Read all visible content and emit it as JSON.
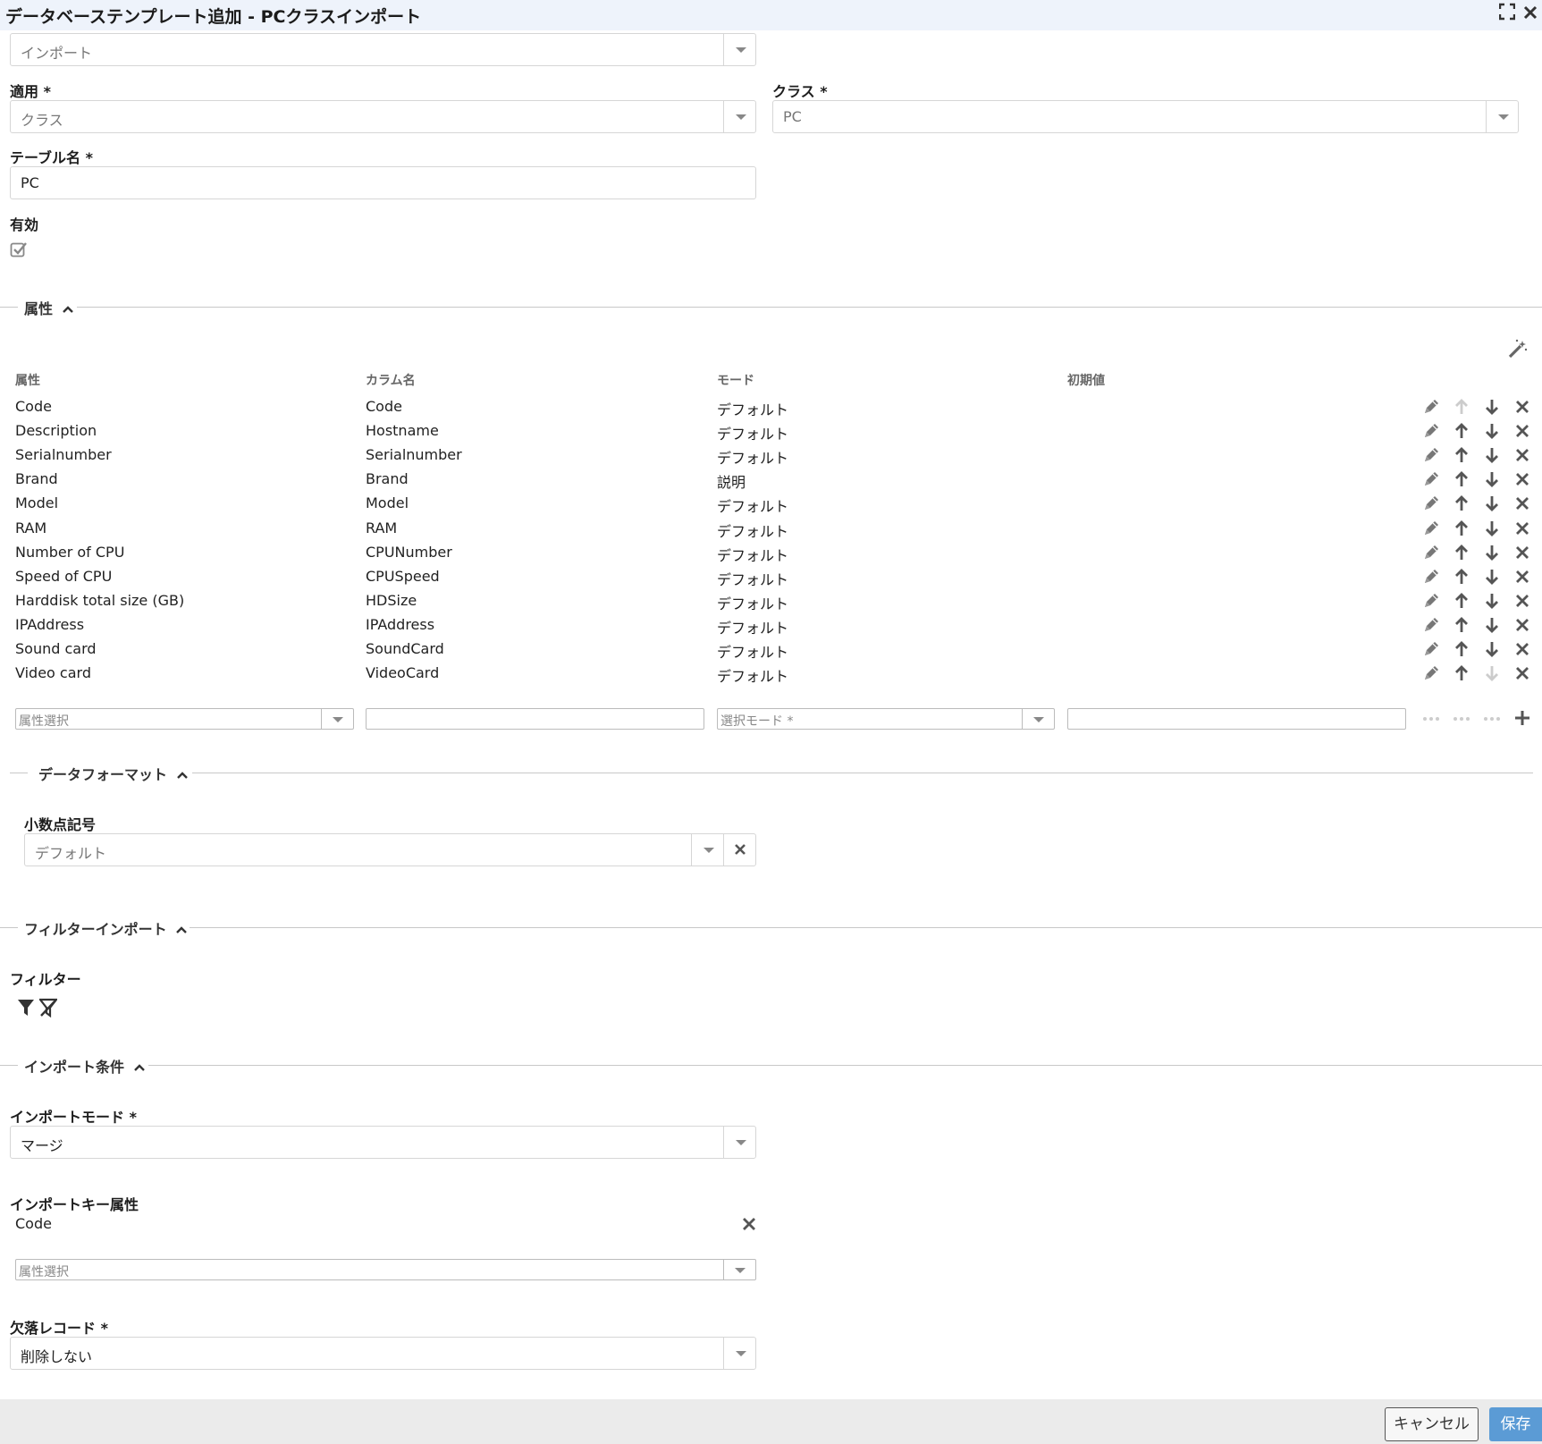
{
  "window": {
    "title": "データベーステンプレート追加 - PCクラスインポート",
    "maximize_icon": "expand-icon",
    "close_icon": "close-icon"
  },
  "form": {
    "type_select": {
      "value": "インポート"
    },
    "apply": {
      "label": "適用 *",
      "value": "クラス"
    },
    "class": {
      "label": "クラス *",
      "value": "PC"
    },
    "table_name": {
      "label": "テーブル名 *",
      "value": "PC"
    },
    "enabled": {
      "label": "有効",
      "checked": true
    }
  },
  "attributes_section": {
    "title": "属性",
    "columns": [
      "属性",
      "カラム名",
      "モード",
      "初期値"
    ],
    "rows": [
      {
        "attribute": "Code",
        "column": "Code",
        "mode": "デフォルト",
        "default": "",
        "up_enabled": false,
        "down_enabled": true
      },
      {
        "attribute": "Description",
        "column": "Hostname",
        "mode": "デフォルト",
        "default": "",
        "up_enabled": true,
        "down_enabled": true
      },
      {
        "attribute": "Serialnumber",
        "column": "Serialnumber",
        "mode": "デフォルト",
        "default": "",
        "up_enabled": true,
        "down_enabled": true
      },
      {
        "attribute": "Brand",
        "column": "Brand",
        "mode": "説明",
        "default": "",
        "up_enabled": true,
        "down_enabled": true
      },
      {
        "attribute": "Model",
        "column": "Model",
        "mode": "デフォルト",
        "default": "",
        "up_enabled": true,
        "down_enabled": true
      },
      {
        "attribute": "RAM",
        "column": "RAM",
        "mode": "デフォルト",
        "default": "",
        "up_enabled": true,
        "down_enabled": true
      },
      {
        "attribute": "Number of CPU",
        "column": "CPUNumber",
        "mode": "デフォルト",
        "default": "",
        "up_enabled": true,
        "down_enabled": true
      },
      {
        "attribute": "Speed of CPU",
        "column": "CPUSpeed",
        "mode": "デフォルト",
        "default": "",
        "up_enabled": true,
        "down_enabled": true
      },
      {
        "attribute": "Harddisk total size (GB)",
        "column": "HDSize",
        "mode": "デフォルト",
        "default": "",
        "up_enabled": true,
        "down_enabled": true
      },
      {
        "attribute": "IPAddress",
        "column": "IPAddress",
        "mode": "デフォルト",
        "default": "",
        "up_enabled": true,
        "down_enabled": true
      },
      {
        "attribute": "Sound card",
        "column": "SoundCard",
        "mode": "デフォルト",
        "default": "",
        "up_enabled": true,
        "down_enabled": true
      },
      {
        "attribute": "Video card",
        "column": "VideoCard",
        "mode": "デフォルト",
        "default": "",
        "up_enabled": true,
        "down_enabled": false
      }
    ],
    "new_row": {
      "attribute_placeholder": "属性選択",
      "mode_placeholder": "選択モード *"
    },
    "row_actions": [
      "pencil-icon",
      "arrow-up-icon",
      "arrow-down-icon",
      "close-icon"
    ],
    "wand_icon": "magic-wand-icon"
  },
  "data_format_section": {
    "title": "データフォーマット",
    "decimal_separator": {
      "label": "小数点記号",
      "value": "デフォルト"
    }
  },
  "filter_section": {
    "title": "フィルターインポート",
    "filter_label": "フィルター",
    "icons": [
      "filter-icon",
      "filter-clear-icon"
    ]
  },
  "import_conditions_section": {
    "title": "インポート条件",
    "import_mode": {
      "label": "インポートモード *",
      "value": "マージ"
    },
    "import_key": {
      "label": "インポートキー属性",
      "items": [
        "Code"
      ],
      "placeholder": "属性選択"
    },
    "missing_records": {
      "label": "欠落レコード *",
      "value": "削除しない"
    }
  },
  "footer": {
    "cancel_label": "キャンセル",
    "save_label": "保存"
  },
  "colors": {
    "title_bar": "#eef3fb",
    "save_button": "#5b9bd5",
    "footer": "#ebebeb"
  }
}
